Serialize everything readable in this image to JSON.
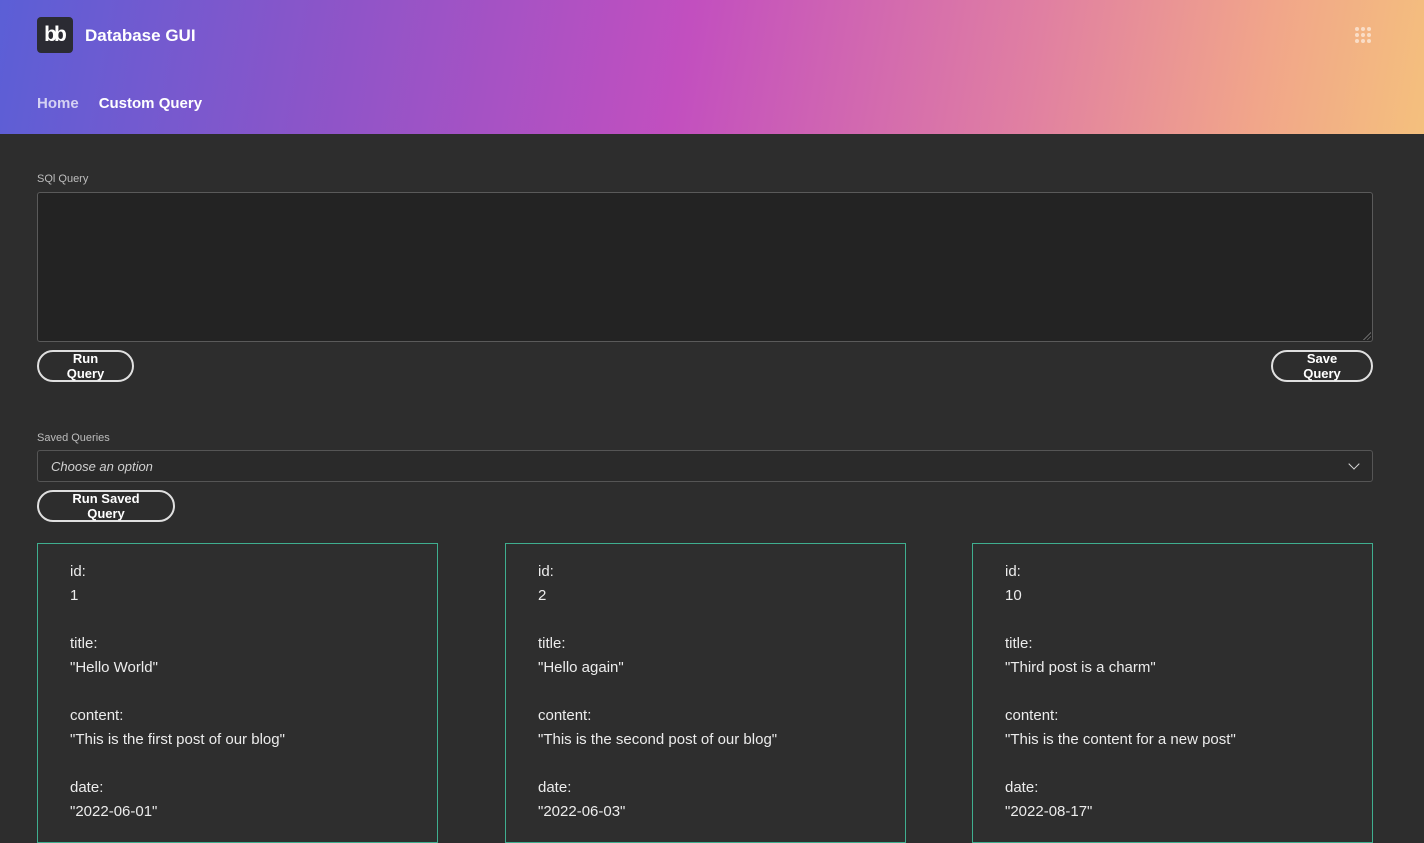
{
  "app": {
    "logo_text": "bb",
    "title": "Database GUI"
  },
  "nav": {
    "home": "Home",
    "custom_query": "Custom Query"
  },
  "sql_query": {
    "label": "SQl Query",
    "value": "",
    "run_label": "Run Query",
    "save_label": "Save Query"
  },
  "saved_queries": {
    "label": "Saved Queries",
    "selected": "Choose an option",
    "run_label": "Run Saved Query"
  },
  "results": [
    {
      "id_label": "id:",
      "id": "1",
      "title_label": "title:",
      "title": "\"Hello World\"",
      "content_label": "content:",
      "content": "\"This is the first post of our blog\"",
      "date_label": "date:",
      "date": "\"2022-06-01\""
    },
    {
      "id_label": "id:",
      "id": "2",
      "title_label": "title:",
      "title": "\"Hello again\"",
      "content_label": "content:",
      "content": "\"This is the second post of our blog\"",
      "date_label": "date:",
      "date": "\"2022-06-03\""
    },
    {
      "id_label": "id:",
      "id": "10",
      "title_label": "title:",
      "title": "\"Third post is a charm\"",
      "content_label": "content:",
      "content": "\"This is the content for a new post\"",
      "date_label": "date:",
      "date": "\"2022-08-17\""
    }
  ],
  "colors": {
    "card_border": "#3fae8f",
    "background": "#2d2d2d"
  },
  "icons": {
    "apps": "apps-grid-icon",
    "dropdown": "chevron-down-icon"
  }
}
